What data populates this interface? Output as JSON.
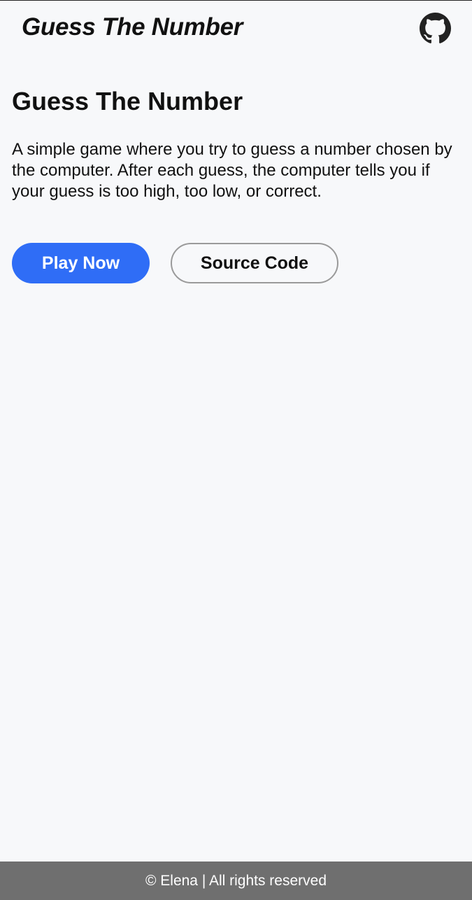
{
  "header": {
    "brand": "Guess The Number",
    "github_icon": "github-icon"
  },
  "hero": {
    "title": "Guess The Number",
    "description": "A simple game where you try to guess a number chosen by the computer. After each guess, the computer tells you if your guess is too high, too low, or correct.",
    "play_label": "Play Now",
    "source_label": "Source Code"
  },
  "footer": {
    "text": "© Elena | All rights reserved"
  },
  "colors": {
    "background": "#f7f8fa",
    "primary_button": "#2f6df6",
    "footer": "#6f6f6f"
  }
}
